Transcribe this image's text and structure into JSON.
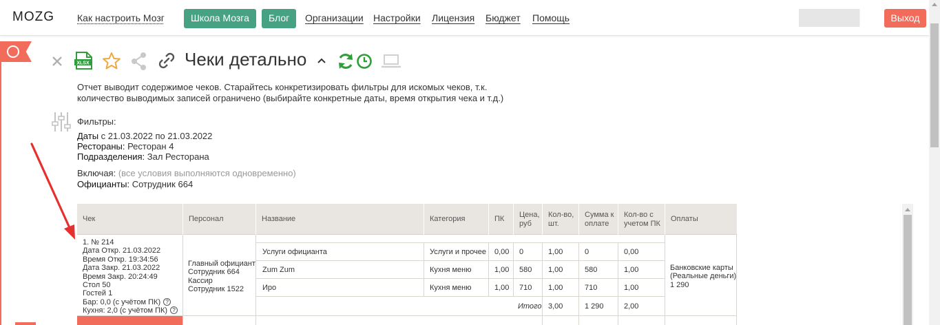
{
  "nav": {
    "logo_text": "MOZG",
    "links": [
      "Как настроить Мозг",
      "Организации",
      "Настройки",
      "Лицензия",
      "Бюджет",
      "Помощь"
    ],
    "buttons": [
      "Школа Мозга",
      "Блог"
    ],
    "logout": "Выход"
  },
  "report": {
    "title": "Чеки детально",
    "description": "Отчет выводит содержимое чеков. Старайтесь конкретизировать фильтры для искомых чеков, т.к. количество выводимых записей ограничено (выбирайте конкретные даты, время открытия чека и т.д.)",
    "filters_label": "Фильтры:",
    "dates_key": "Даты",
    "dates_value": " с 21.03.2022 по 21.03.2022",
    "restaurants_key": "Рестораны:",
    "restaurants_value": " Ресторан 4",
    "divisions_key": "Подразделения:",
    "divisions_value": " Зал Ресторана",
    "including_key": "Включая:",
    "including_value": " (все условия выполняются одновременно)",
    "waiters_key": "Официанты:",
    "waiters_value": " Сотрудник 664"
  },
  "table": {
    "headers": [
      "Чек",
      "Персонал",
      "Название",
      "Категория",
      "ПК",
      "Цена, руб",
      "Кол-во, шт.",
      "Сумма к оплате",
      "Кол-во с учетом ПК",
      "Оплаты"
    ],
    "check_lines": [
      "1. № 214",
      "Дата Откр. 21.03.2022",
      "Время Откр. 19:34:56",
      "Дата Закр. 21.03.2022",
      "Время Закр. 20:24:49",
      "Стол 50",
      "Гостей 1",
      "Бар: 0,0 (с учётом ПК)",
      "Кухня: 2,0 (с учётом ПК)"
    ],
    "help_glyph": "?",
    "staff_lines": [
      "Главный официант",
      "Сотрудник 664",
      "Кассир",
      "Сотрудник 1522"
    ],
    "items": [
      {
        "name": "Услуги официанта",
        "category": "Услуги и прочее",
        "pk": "0,00",
        "price": "0",
        "qty": "1,00",
        "sum": "0",
        "qty_pk": "0,00"
      },
      {
        "name": "Zum Zum",
        "category": "Кухня меню",
        "pk": "1,00",
        "price": "580",
        "qty": "1,00",
        "sum": "580",
        "qty_pk": "1,00"
      },
      {
        "name": "Иро",
        "category": "Кухня меню",
        "pk": "1,00",
        "price": "710",
        "qty": "1,00",
        "sum": "710",
        "qty_pk": "1,00"
      }
    ],
    "total": {
      "label": "Итого",
      "qty": "3,00",
      "sum": "1 290",
      "qty_pk": "2,00"
    },
    "payment_lines": [
      "Банковские карты",
      "(Реальные деньги)",
      "1 290"
    ]
  }
}
